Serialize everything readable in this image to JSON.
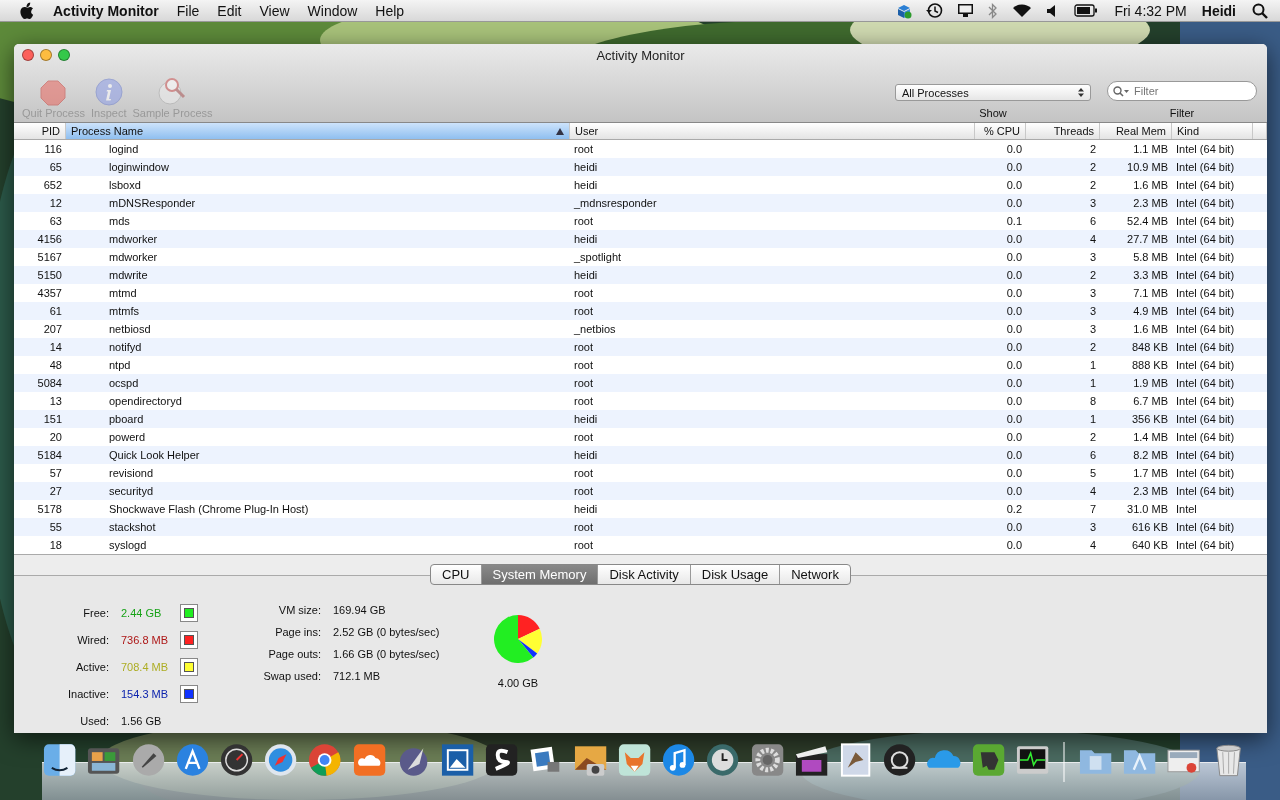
{
  "menu_bar": {
    "app_name": "Activity Monitor",
    "menus": [
      "File",
      "Edit",
      "View",
      "Window",
      "Help"
    ],
    "clock": "Fri 4:32 PM",
    "user": "Heidi"
  },
  "window": {
    "title": "Activity Monitor"
  },
  "toolbar": {
    "buttons": [
      {
        "kind": "quit",
        "label": "Quit Process",
        "disabled": true
      },
      {
        "kind": "inspect",
        "label": "Inspect",
        "disabled": true
      },
      {
        "kind": "sample",
        "label": "Sample Process",
        "disabled": true
      }
    ],
    "show": {
      "value": "All Processes",
      "label": "Show"
    },
    "filter": {
      "placeholder": "Filter",
      "label": "Filter"
    }
  },
  "table": {
    "columns": [
      {
        "label": "PID",
        "sorted": false
      },
      {
        "label": "Process Name",
        "sorted": true
      },
      {
        "label": "User",
        "sorted": false
      },
      {
        "label": "% CPU",
        "sorted": false
      },
      {
        "label": "Threads",
        "sorted": false
      },
      {
        "label": "Real Mem",
        "sorted": false
      },
      {
        "label": "Kind",
        "sorted": false
      }
    ],
    "rows": [
      [
        "116",
        "logind",
        "root",
        "0.0",
        "2",
        "1.1 MB",
        "Intel (64 bit)"
      ],
      [
        "65",
        "loginwindow",
        "heidi",
        "0.0",
        "2",
        "10.9 MB",
        "Intel (64 bit)"
      ],
      [
        "652",
        "lsboxd",
        "heidi",
        "0.0",
        "2",
        "1.6 MB",
        "Intel (64 bit)"
      ],
      [
        "12",
        "mDNSResponder",
        "_mdnsresponder",
        "0.0",
        "3",
        "2.3 MB",
        "Intel (64 bit)"
      ],
      [
        "63",
        "mds",
        "root",
        "0.1",
        "6",
        "52.4 MB",
        "Intel (64 bit)"
      ],
      [
        "4156",
        "mdworker",
        "heidi",
        "0.0",
        "4",
        "27.7 MB",
        "Intel (64 bit)"
      ],
      [
        "5167",
        "mdworker",
        "_spotlight",
        "0.0",
        "3",
        "5.8 MB",
        "Intel (64 bit)"
      ],
      [
        "5150",
        "mdwrite",
        "heidi",
        "0.0",
        "2",
        "3.3 MB",
        "Intel (64 bit)"
      ],
      [
        "4357",
        "mtmd",
        "root",
        "0.0",
        "3",
        "7.1 MB",
        "Intel (64 bit)"
      ],
      [
        "61",
        "mtmfs",
        "root",
        "0.0",
        "3",
        "4.9 MB",
        "Intel (64 bit)"
      ],
      [
        "207",
        "netbiosd",
        "_netbios",
        "0.0",
        "3",
        "1.6 MB",
        "Intel (64 bit)"
      ],
      [
        "14",
        "notifyd",
        "root",
        "0.0",
        "2",
        "848 KB",
        "Intel (64 bit)"
      ],
      [
        "48",
        "ntpd",
        "root",
        "0.0",
        "1",
        "888 KB",
        "Intel (64 bit)"
      ],
      [
        "5084",
        "ocspd",
        "root",
        "0.0",
        "1",
        "1.9 MB",
        "Intel (64 bit)"
      ],
      [
        "13",
        "opendirectoryd",
        "root",
        "0.0",
        "8",
        "6.7 MB",
        "Intel (64 bit)"
      ],
      [
        "151",
        "pboard",
        "heidi",
        "0.0",
        "1",
        "356 KB",
        "Intel (64 bit)"
      ],
      [
        "20",
        "powerd",
        "root",
        "0.0",
        "2",
        "1.4 MB",
        "Intel (64 bit)"
      ],
      [
        "5184",
        "Quick Look Helper",
        "heidi",
        "0.0",
        "6",
        "8.2 MB",
        "Intel (64 bit)"
      ],
      [
        "57",
        "revisiond",
        "root",
        "0.0",
        "5",
        "1.7 MB",
        "Intel (64 bit)"
      ],
      [
        "27",
        "securityd",
        "root",
        "0.0",
        "4",
        "2.3 MB",
        "Intel (64 bit)"
      ],
      [
        "5178",
        "Shockwave Flash (Chrome Plug-In Host)",
        "heidi",
        "0.2",
        "7",
        "31.0 MB",
        "Intel"
      ],
      [
        "55",
        "stackshot",
        "root",
        "0.0",
        "3",
        "616 KB",
        "Intel (64 bit)"
      ],
      [
        "18",
        "syslogd",
        "root",
        "0.0",
        "4",
        "640 KB",
        "Intel (64 bit)"
      ]
    ]
  },
  "tabs": [
    {
      "label": "CPU",
      "selected": false
    },
    {
      "label": "System Memory",
      "selected": true
    },
    {
      "label": "Disk Activity",
      "selected": false
    },
    {
      "label": "Disk Usage",
      "selected": false
    },
    {
      "label": "Network",
      "selected": false
    }
  ],
  "memory": {
    "stats": [
      {
        "label": "Free:",
        "value": "2.44 GB",
        "color": "#22ee22"
      },
      {
        "label": "Wired:",
        "value": "736.8 MB",
        "color": "#ff2222"
      },
      {
        "label": "Active:",
        "value": "708.4 MB",
        "color": "#ffff33"
      },
      {
        "label": "Inactive:",
        "value": "154.3 MB",
        "color": "#1133ff"
      }
    ],
    "used": {
      "label": "Used:",
      "value": "1.56 GB"
    },
    "vm": [
      {
        "label": "VM size:",
        "value": "169.94 GB"
      },
      {
        "label": "Page ins:",
        "value": "2.52 GB (0 bytes/sec)"
      },
      {
        "label": "Page outs:",
        "value": "1.66 GB (0 bytes/sec)"
      },
      {
        "label": "Swap used:",
        "value": "712.1 MB"
      }
    ],
    "total": "4.00 GB"
  }
}
